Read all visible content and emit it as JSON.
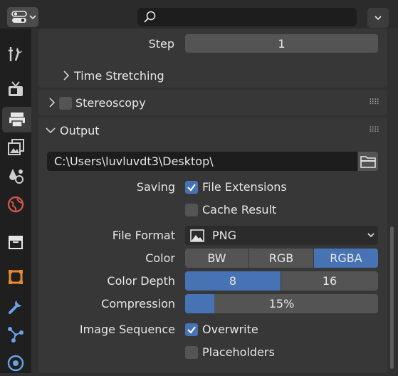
{
  "header": {
    "search_placeholder": ""
  },
  "tabs": [
    {
      "icon": "tool-icon"
    },
    {
      "icon": "render-icon"
    },
    {
      "icon": "output-icon",
      "active": true
    },
    {
      "icon": "view-layer-icon"
    },
    {
      "icon": "scene-icon"
    },
    {
      "icon": "world-icon"
    },
    {
      "icon": "collection-icon"
    },
    {
      "icon": "object-icon"
    },
    {
      "icon": "modifier-icon"
    },
    {
      "icon": "particles-icon"
    },
    {
      "icon": "physics-icon"
    }
  ],
  "frame_range": {
    "step_label": "Step",
    "step_value": "1",
    "time_stretching_label": "Time Stretching"
  },
  "stereoscopy": {
    "label": "Stereoscopy",
    "enabled": false
  },
  "output": {
    "label": "Output",
    "path": "C:\\Users\\luvluvdt3\\Desktop\\",
    "saving_label": "Saving",
    "file_extensions_label": "File Extensions",
    "file_extensions_checked": true,
    "cache_result_label": "Cache Result",
    "cache_result_checked": false,
    "file_format_label": "File Format",
    "file_format_value": "PNG",
    "color_label": "Color",
    "color_options": [
      "BW",
      "RGB",
      "RGBA"
    ],
    "color_selected": "RGBA",
    "color_depth_label": "Color Depth",
    "color_depth_options": [
      "8",
      "16"
    ],
    "color_depth_selected": "8",
    "compression_label": "Compression",
    "compression_value": "15%",
    "compression_fraction": 0.15,
    "image_sequence_label": "Image Sequence",
    "overwrite_label": "Overwrite",
    "overwrite_checked": true,
    "placeholders_label": "Placeholders",
    "placeholders_checked": false
  },
  "colors": {
    "accent": "#4772b3",
    "field": "#545454",
    "panel": "#373737",
    "background": "#303030"
  }
}
